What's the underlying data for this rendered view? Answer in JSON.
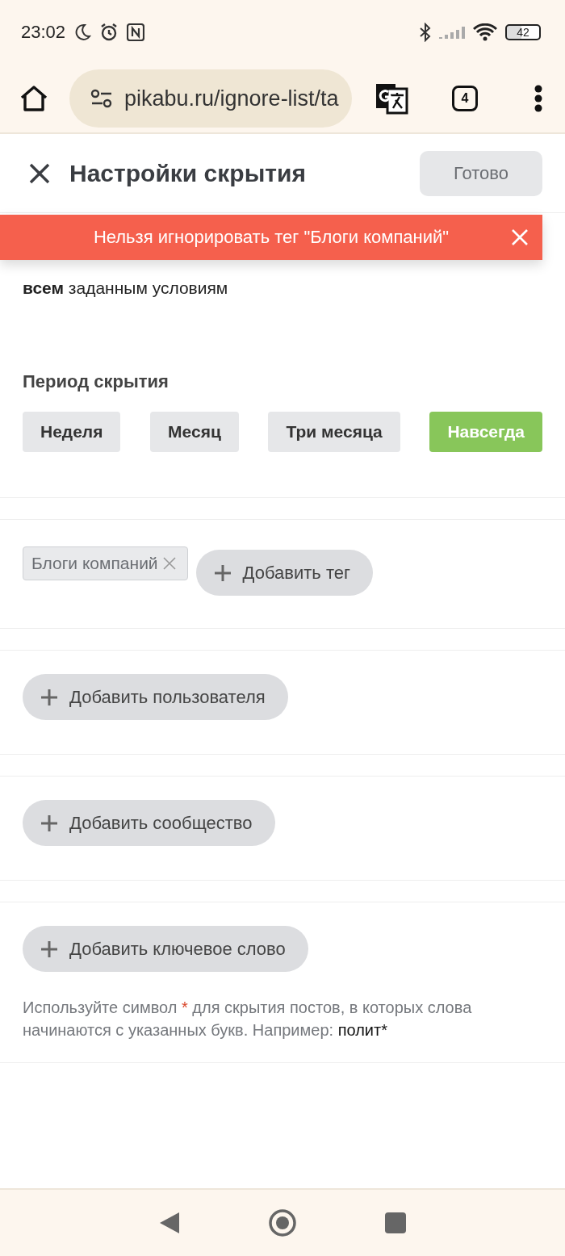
{
  "status_bar": {
    "time": "23:02",
    "battery": "42"
  },
  "browser": {
    "url": "pikabu.ru/ignore-list/ta",
    "tab_count": "4"
  },
  "header": {
    "title": "Настройки скрытия",
    "done_button": "Готово"
  },
  "toast": {
    "text": "Нельзя игнорировать тег \"Блоги компаний\""
  },
  "description": "**всем** заданным условиям",
  "period": {
    "title": "Период скрытия",
    "options": [
      {
        "label": "Неделя",
        "selected": false
      },
      {
        "label": "Месяц",
        "selected": false
      },
      {
        "label": "Три месяца",
        "selected": false
      },
      {
        "label": "Навсегда",
        "selected": true
      }
    ]
  },
  "tags": {
    "items": [
      "Блоги компаний"
    ],
    "add_button": "Добавить тег"
  },
  "users": {
    "add_button": "Добавить пользователя"
  },
  "communities": {
    "add_button": "Добавить сообщество"
  },
  "keywords": {
    "add_button": "Добавить ключевое слово",
    "hint": {
      "before": "Используйте символ",
      "mark": "*",
      "after": "для скрытия постов, в которых слова начинаются с указанных букв. Например:",
      "example": "полит*"
    }
  }
}
